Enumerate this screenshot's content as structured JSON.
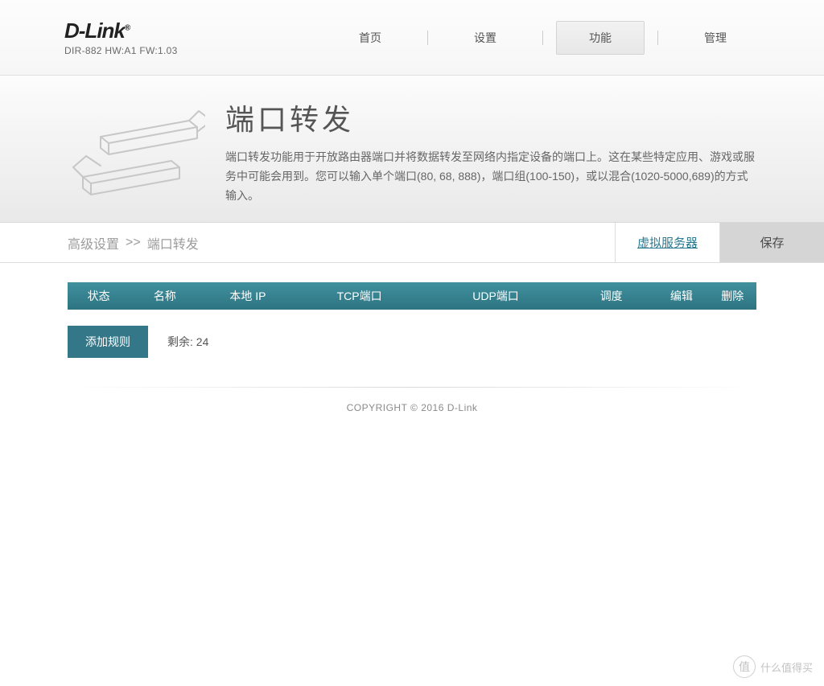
{
  "brand": {
    "name": "D-Link",
    "model": "DIR-882 HW:A1 FW:1.03"
  },
  "nav": {
    "items": [
      "首页",
      "设置",
      "功能",
      "管理"
    ],
    "active_index": 2
  },
  "page": {
    "title": "端口转发",
    "description": "端口转发功能用于开放路由器端口并将数据转发至网络内指定设备的端口上。这在某些特定应用、游戏或服务中可能会用到。您可以输入单个端口(80, 68, 888)，端口组(100-150)，或以混合(1020-5000,689)的方式输入。"
  },
  "breadcrumb": {
    "root": "高级设置",
    "sep": ">>",
    "current": "端口转发"
  },
  "actions": {
    "virtual_server": "虚拟服务器",
    "save": "保存"
  },
  "table": {
    "columns": {
      "status": "状态",
      "name": "名称",
      "local_ip": "本地 IP",
      "tcp": "TCP端口",
      "udp": "UDP端口",
      "schedule": "调度",
      "edit": "编辑",
      "delete": "删除"
    }
  },
  "add_button": "添加规则",
  "remaining_label": "剩余: 24",
  "copyright": "COPYRIGHT © 2016 D-Link",
  "watermark": {
    "badge": "值",
    "text": "什么值得买"
  }
}
